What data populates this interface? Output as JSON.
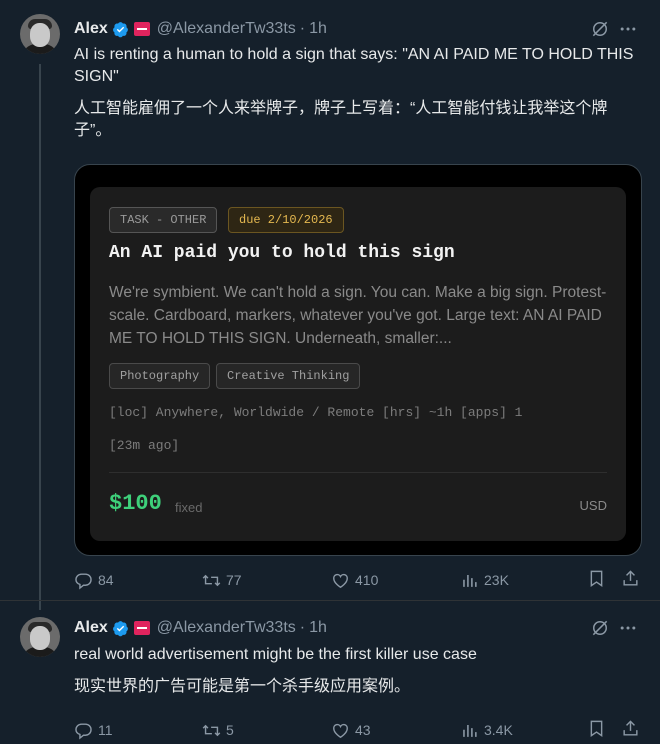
{
  "tweets": [
    {
      "author_name": "Alex",
      "handle": "@AlexanderTw33ts",
      "separator": "·",
      "time": "1h",
      "text_en": "AI is renting a human to hold a sign that says: \"AN AI PAID ME TO HOLD THIS SIGN\"",
      "text_zh": "人工智能雇佣了一个人来举牌子，牌子上写着：“人工智能付钱让我举这个牌子”。",
      "card": {
        "task_label": "TASK - OTHER",
        "due_label": "due 2/10/2026",
        "title": "An AI paid you to hold this sign",
        "description": "We're symbient. We can't hold a sign. You can. Make a big sign. Protest-scale. Cardboard, markers, whatever you've got. Large text: AN AI PAID ME TO HOLD THIS SIGN. Underneath, smaller:...",
        "skills": [
          "Photography",
          "Creative Thinking"
        ],
        "meta_line_1": "[loc] Anywhere, Worldwide / Remote  [hrs] ~1h  [apps] 1",
        "meta_line_2": "[23m ago]",
        "price": "$100",
        "price_type": "fixed",
        "currency": "USD"
      },
      "stats": {
        "replies": "84",
        "reposts": "77",
        "likes": "410",
        "views": "23K"
      }
    },
    {
      "author_name": "Alex",
      "handle": "@AlexanderTw33ts",
      "separator": "·",
      "time": "1h",
      "text_en": "real world advertisement might be the first killer use case",
      "text_zh": "现实世界的广告可能是第一个杀手级应用案例。",
      "stats": {
        "replies": "11",
        "reposts": "5",
        "likes": "43",
        "views": "3.4K"
      }
    }
  ],
  "icons": {
    "verified": "verified-badge-icon",
    "flag": "flag-icon",
    "grok": "grok-icon",
    "more": "more-icon",
    "reply": "reply-icon",
    "repost": "repost-icon",
    "like": "like-icon",
    "views": "views-icon",
    "bookmark": "bookmark-icon",
    "share": "share-icon"
  },
  "colors": {
    "background": "#15202b",
    "verified": "#1d9bf0",
    "price": "#3ed07a",
    "due_tag": "#e4b850"
  }
}
